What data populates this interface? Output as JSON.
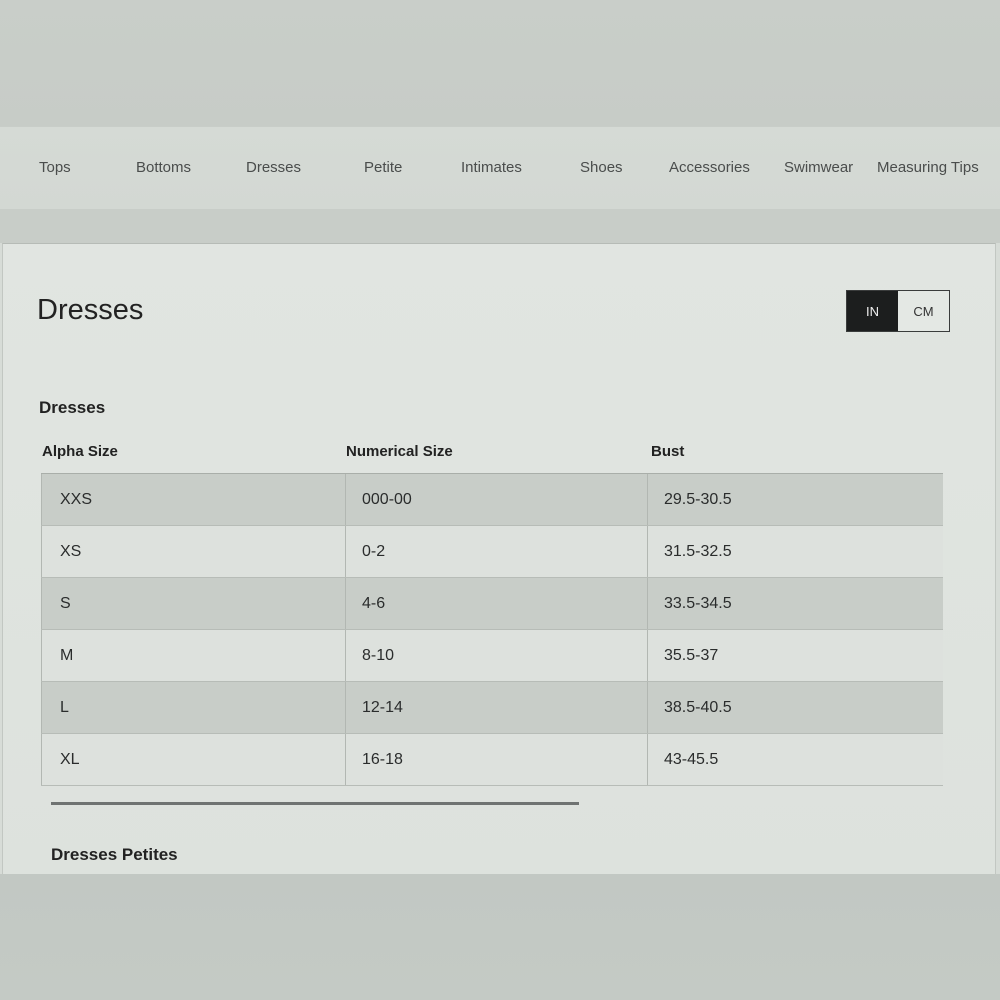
{
  "nav": {
    "items": [
      "Tops",
      "Bottoms",
      "Dresses",
      "Petite",
      "Intimates",
      "Shoes",
      "Accessories",
      "Swimwear",
      "Measuring Tips"
    ]
  },
  "page": {
    "title": "Dresses"
  },
  "unit_toggle": {
    "options": [
      "IN",
      "CM"
    ],
    "selected": "IN"
  },
  "size_table": {
    "title": "Dresses",
    "columns": [
      "Alpha Size",
      "Numerical Size",
      "Bust"
    ],
    "rows": [
      [
        "XXS",
        "000-00",
        "29.5-30.5"
      ],
      [
        "XS",
        "0-2",
        "31.5-32.5"
      ],
      [
        "S",
        "4-6",
        "33.5-34.5"
      ],
      [
        "M",
        "8-10",
        "35.5-37"
      ],
      [
        "L",
        "12-14",
        "38.5-40.5"
      ],
      [
        "XL",
        "16-18",
        "43-45.5"
      ]
    ]
  },
  "next_section": {
    "title": "Dresses Petites"
  }
}
